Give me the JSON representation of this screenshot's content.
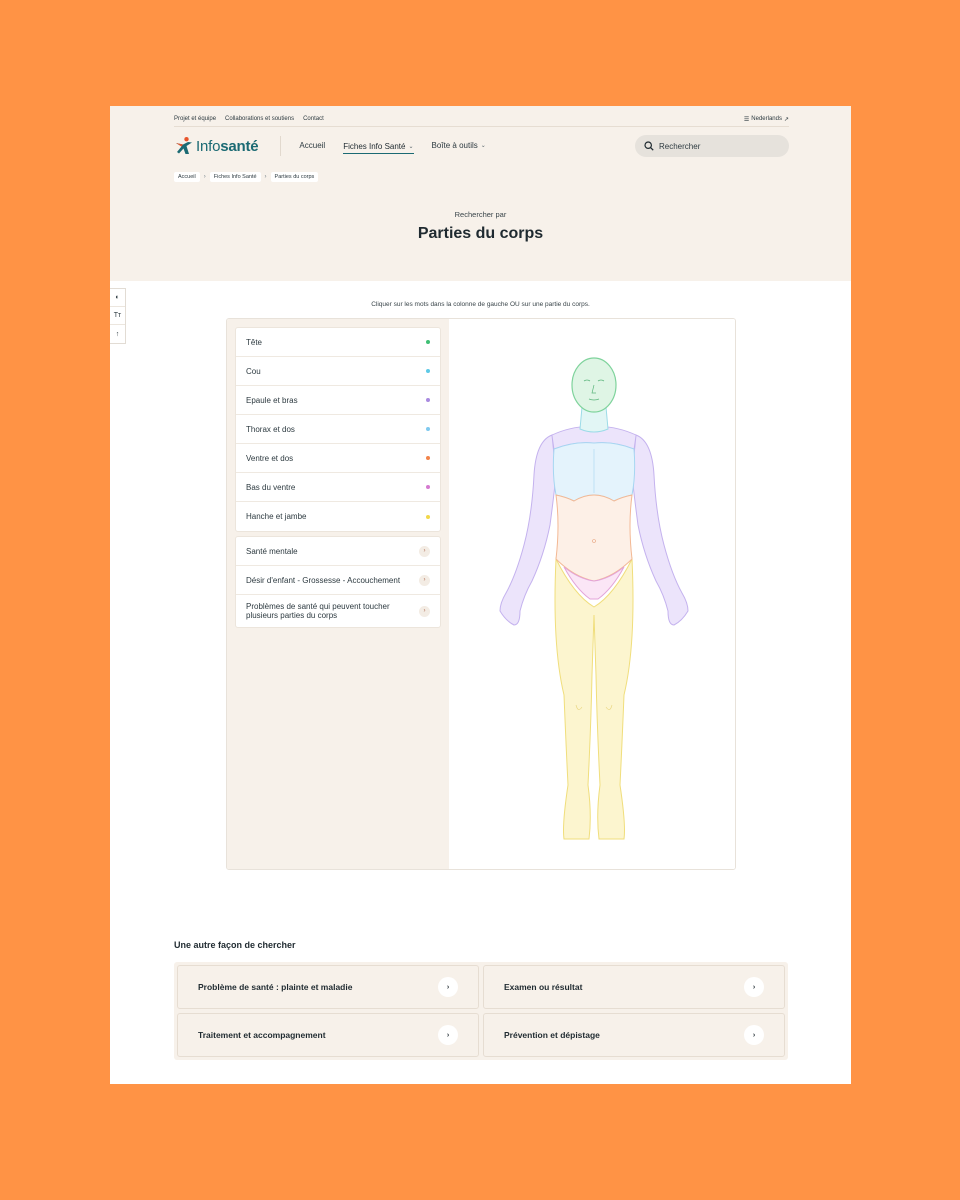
{
  "topbar": {
    "links": [
      "Projet et équipe",
      "Collaborations et soutiens",
      "Contact"
    ],
    "language": "Nederlands"
  },
  "header": {
    "logo": {
      "part1": "Info",
      "part2": "santé"
    },
    "nav": [
      {
        "label": "Accueil"
      },
      {
        "label": "Fiches Info Santé"
      },
      {
        "label": "Boîte à outils"
      }
    ],
    "search_placeholder": "Rechercher"
  },
  "breadcrumb": [
    "Accueil",
    "Fiches Info Santé",
    "Parties du corps"
  ],
  "hero": {
    "subtitle": "Rechercher par",
    "title": "Parties du corps"
  },
  "tools": {
    "contrast": "◐",
    "text_size": "Tт",
    "top": "↑"
  },
  "instruction": "Cliquer sur les mots dans la colonne de gauche OU sur une partie du corps.",
  "body_parts": [
    {
      "label": "Tête",
      "color": "#3fbf74"
    },
    {
      "label": "Cou",
      "color": "#5ec9e6"
    },
    {
      "label": "Epaule et bras",
      "color": "#a98ae0"
    },
    {
      "label": "Thorax et dos",
      "color": "#7fc9ef"
    },
    {
      "label": "Ventre et dos",
      "color": "#f2844b"
    },
    {
      "label": "Bas du ventre",
      "color": "#d57ad0"
    },
    {
      "label": "Hanche et jambe",
      "color": "#f2d84a"
    }
  ],
  "topics": [
    {
      "label": "Santé mentale"
    },
    {
      "label": "Désir d'enfant - Grossesse - Accouchement"
    },
    {
      "label": "Problèmes de santé qui peuvent toucher plusieurs parties du corps"
    }
  ],
  "other_search": {
    "title": "Une autre façon de chercher",
    "cards": [
      {
        "label": "Problème de santé : plainte et maladie"
      },
      {
        "label": "Examen ou résultat"
      },
      {
        "label": "Traitement et accompagnement"
      },
      {
        "label": "Prévention et dépistage"
      }
    ]
  }
}
